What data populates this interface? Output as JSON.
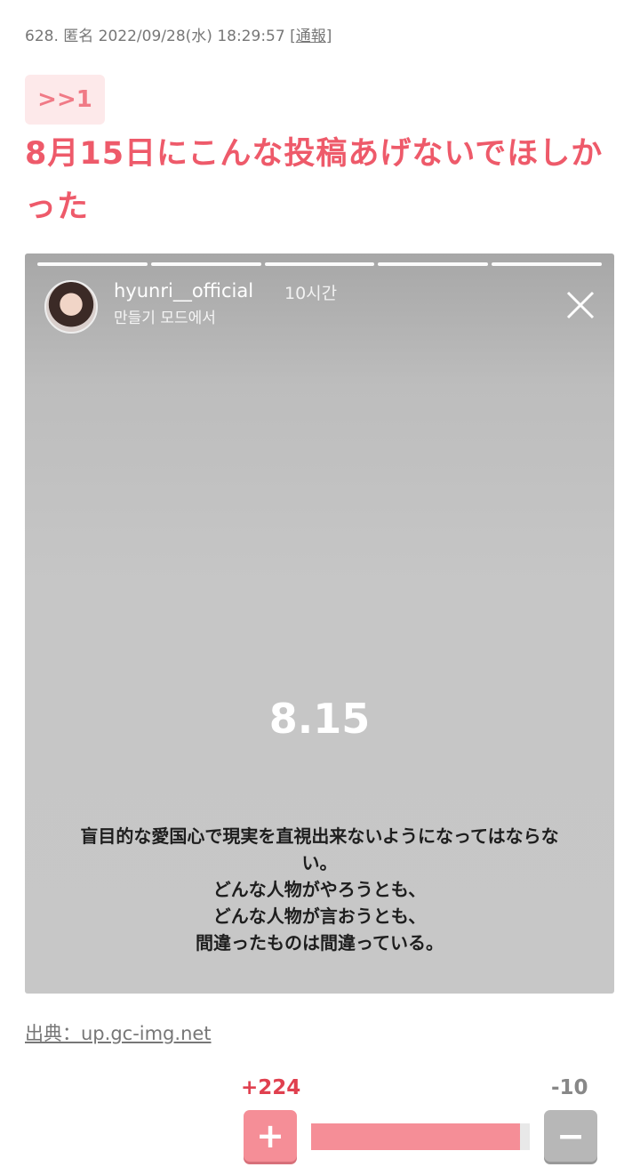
{
  "post": {
    "number": "628.",
    "author": "匿名",
    "datetime": "2022/09/28(水) 18:29:57",
    "report_label": "通報",
    "anchor": ">>1",
    "text": "8月15日にこんな投稿あげないでほしかった"
  },
  "story": {
    "username": "hyunri__official",
    "time": "10시간",
    "subline": "만들기 모드에서",
    "progress_segments": 5,
    "progress_completed": 5,
    "big_text": "8.15",
    "lines": [
      "盲目的な愛国心で現実を直視出来ないようになってはならな",
      "い。",
      "どんな人物がやろうとも、",
      "どんな人物が言おうとも、",
      "間違ったものは間違っている。"
    ]
  },
  "source": {
    "label": "出典：up.gc-img.net"
  },
  "votes": {
    "plus": "+224",
    "minus": "-10",
    "plus_icon": "+",
    "minus_icon": "−",
    "ratio": 0.957,
    "plus_color": "#f58e97",
    "minus_color": "#b7b7b7"
  },
  "colors": {
    "accent": "#ee5a6a",
    "anchor_bg": "#fde9ea"
  }
}
